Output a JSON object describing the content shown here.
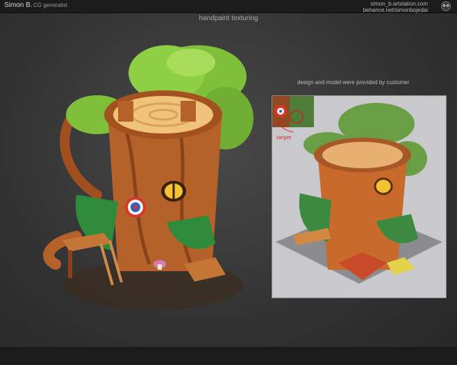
{
  "header": {
    "author": "Simon B.",
    "role": "CG generalist",
    "link_artstation": "simon_b.artstation.com",
    "link_behance": "behance.net/simonbojedai",
    "logo_icon": "owl-logo-icon"
  },
  "title": "handpaint texturing",
  "reference": {
    "caption": "design and model were provided by customer",
    "annotation": "target"
  },
  "colors": {
    "bar": "#1b1b1b",
    "wood": "#b5612a",
    "leaves": "#7fbf3a",
    "roof": "#2f8a3c"
  }
}
